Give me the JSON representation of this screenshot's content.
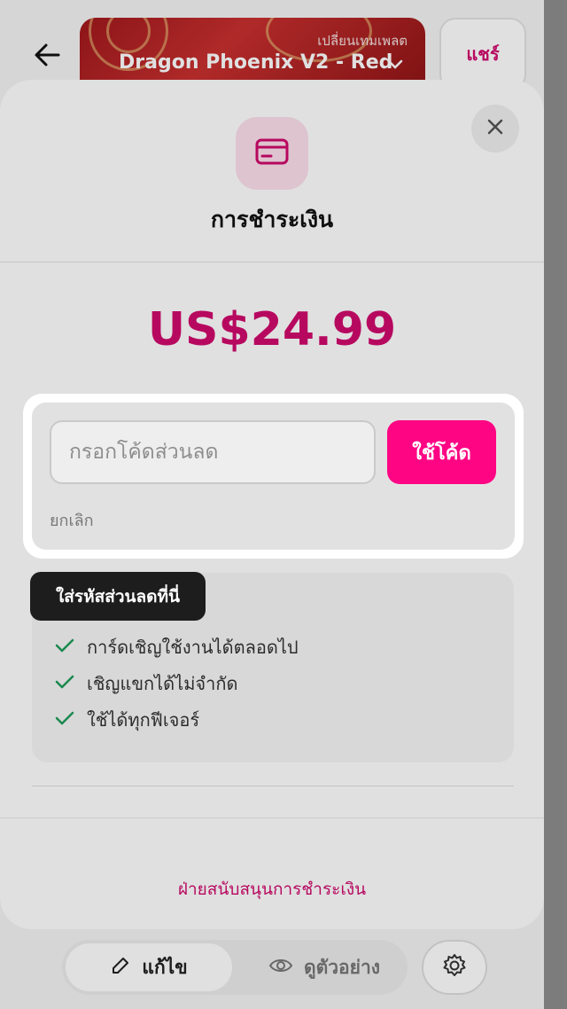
{
  "app": {
    "template": {
      "change_label": "เปลี่ยนเทมเพลต",
      "name": "Dragon Phoenix V2 - Red"
    },
    "share_label": "แชร์",
    "bottom_bar": {
      "edit_label": "แก้ไข",
      "preview_label": "ดูตัวอย่าง"
    }
  },
  "modal": {
    "title": "การชำระเงิน",
    "price": "US$24.99",
    "coupon": {
      "placeholder": "กรอกโค้ดส่วนลด",
      "value": "",
      "apply_label": "ใช้โค้ด",
      "cancel_label": "ยกเลิก"
    },
    "features": [
      {
        "label": "การ์ดเชิญใช้งานได้ตลอดไป"
      },
      {
        "label": "เชิญแขกได้ไม่จำกัด"
      },
      {
        "label": "ใช้ได้ทุกฟีเจอร์"
      }
    ],
    "support_label": "ฝ่ายสนับสนุนการชำระเงิน"
  },
  "tooltip": {
    "text": "ใส่รหัสส่วนลดที่นี่"
  },
  "colors": {
    "accent": "#fe0584",
    "price": "#d10a6d",
    "tooltip_bg": "#1d1d1d"
  },
  "icons": {
    "back": "arrow-left-icon",
    "close": "close-icon",
    "payment": "credit-card-icon",
    "check": "check-icon",
    "edit": "pencil-icon",
    "preview": "eye-icon",
    "settings": "gear-icon"
  }
}
